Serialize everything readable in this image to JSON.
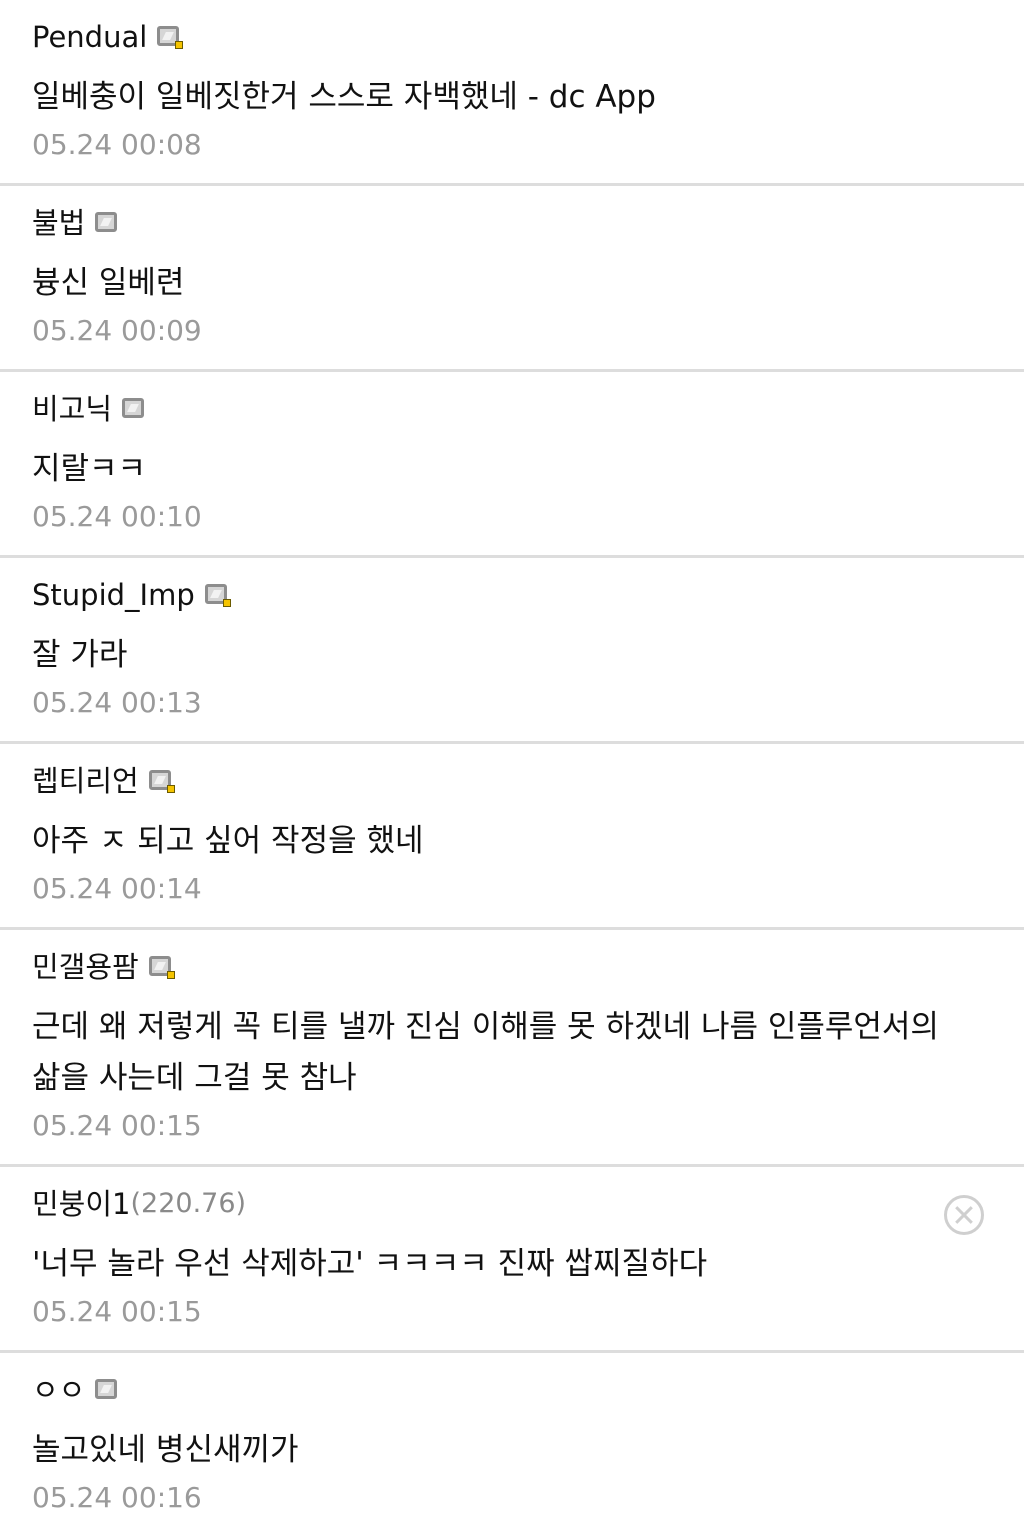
{
  "comments": [
    {
      "author": "Pendual",
      "icon": "gallog-icon-fixed",
      "text": "일베충이 일베짓한거 스스로 자백했네 - dc App",
      "time": "05.24 00:08"
    },
    {
      "author": "불법",
      "icon": "gallog-icon",
      "text": "븅신 일베련",
      "time": "05.24 00:09"
    },
    {
      "author": "비고닉",
      "icon": "gallog-icon",
      "text": "지랄ㅋㅋ",
      "time": "05.24 00:10"
    },
    {
      "author": "Stupid_Imp",
      "icon": "gallog-icon-fixed",
      "text": "잘 가라",
      "time": "05.24 00:13"
    },
    {
      "author": "렙티리언",
      "icon": "gallog-icon-fixed",
      "text": "아주 ㅈ 되고 싶어 작정을 했네",
      "time": "05.24 00:14"
    },
    {
      "author": "민갤용팜",
      "icon": "gallog-icon-fixed",
      "text": "근데 왜 저렇게 꼭 티를 낼까 진심 이해를 못 하겠네 나름 인플루언서의 삶을 사는데 그걸 못 참나",
      "time": "05.24 00:15"
    },
    {
      "author": "민붕이1",
      "ip": "(220.76)",
      "text": "'너무 놀라 우선 삭제하고' ㅋㅋㅋㅋ 진짜 쌉찌질하다",
      "time": "05.24 00:15",
      "delete_icon": "close-circle-icon"
    },
    {
      "author": "ㅇㅇ",
      "icon": "gallog-icon",
      "text": "놀고있네 병신새끼가",
      "time": "05.24 00:16"
    }
  ],
  "colors": {
    "separator": "#dddddd",
    "timestamp": "#9a9a9a",
    "ip": "#8a8a8a",
    "fixed_badge": "#f5c400"
  }
}
